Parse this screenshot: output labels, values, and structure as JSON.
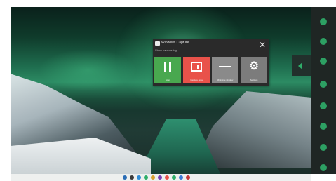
{
  "popup": {
    "title": "Windows Capture",
    "subtitle": "Show capture log",
    "close_icon": "close-icon",
    "tiles": [
      {
        "id": "stop",
        "label": "Stop",
        "color": "#49a84f",
        "icon": "pause-icon"
      },
      {
        "id": "record",
        "label": "Capture area",
        "color": "#e9524a",
        "icon": "record-icon"
      },
      {
        "id": "minimize",
        "label": "Minimize window",
        "color": "#8a8a8a",
        "icon": "minimize-icon"
      },
      {
        "id": "settings",
        "label": "Settings",
        "color": "#7c7c7c",
        "icon": "gear-icon"
      }
    ]
  },
  "dock": {
    "accent": "#2fae6a",
    "icons": [
      "app-icon-1",
      "app-icon-2",
      "app-icon-3",
      "app-icon-4",
      "app-icon-5",
      "app-icon-6",
      "app-icon-7",
      "app-icon-8"
    ]
  },
  "taskbar": {
    "icons": [
      "taskbar-icon-1",
      "taskbar-icon-2",
      "taskbar-icon-3",
      "taskbar-icon-4",
      "taskbar-icon-5",
      "taskbar-icon-6",
      "taskbar-icon-7",
      "taskbar-icon-8",
      "taskbar-icon-9",
      "taskbar-icon-10"
    ]
  }
}
